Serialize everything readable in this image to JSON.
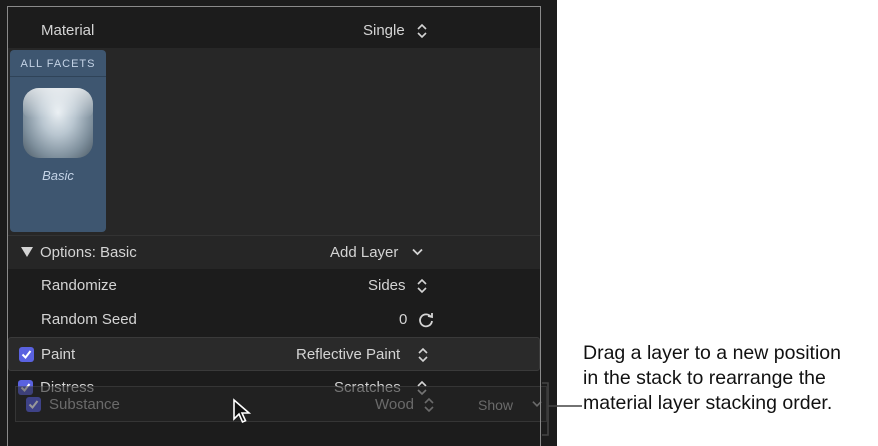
{
  "material": {
    "label": "Material",
    "value": "Single"
  },
  "facet": {
    "title": "ALL FACETS",
    "name": "Basic"
  },
  "options": {
    "label": "Options: Basic",
    "add_layer": "Add Layer"
  },
  "randomize": {
    "label": "Randomize",
    "value": "Sides"
  },
  "random_seed": {
    "label": "Random Seed",
    "value": "0"
  },
  "paint": {
    "label": "Paint",
    "value": "Reflective Paint",
    "checked": true
  },
  "distress": {
    "label": "Distress",
    "value": "Scratches",
    "checked": true
  },
  "dragged_layer": {
    "label": "Substance",
    "value": "Wood",
    "show": "Show",
    "checked": true
  },
  "callout": {
    "line1": "Drag a layer to a new position",
    "line2": "in the stack to rearrange the",
    "line3": "material layer stacking order."
  },
  "colors": {
    "checkbox": "#5a62e0",
    "facet_bg": "#3e5670",
    "panel_bg": "#1c1c1c"
  }
}
